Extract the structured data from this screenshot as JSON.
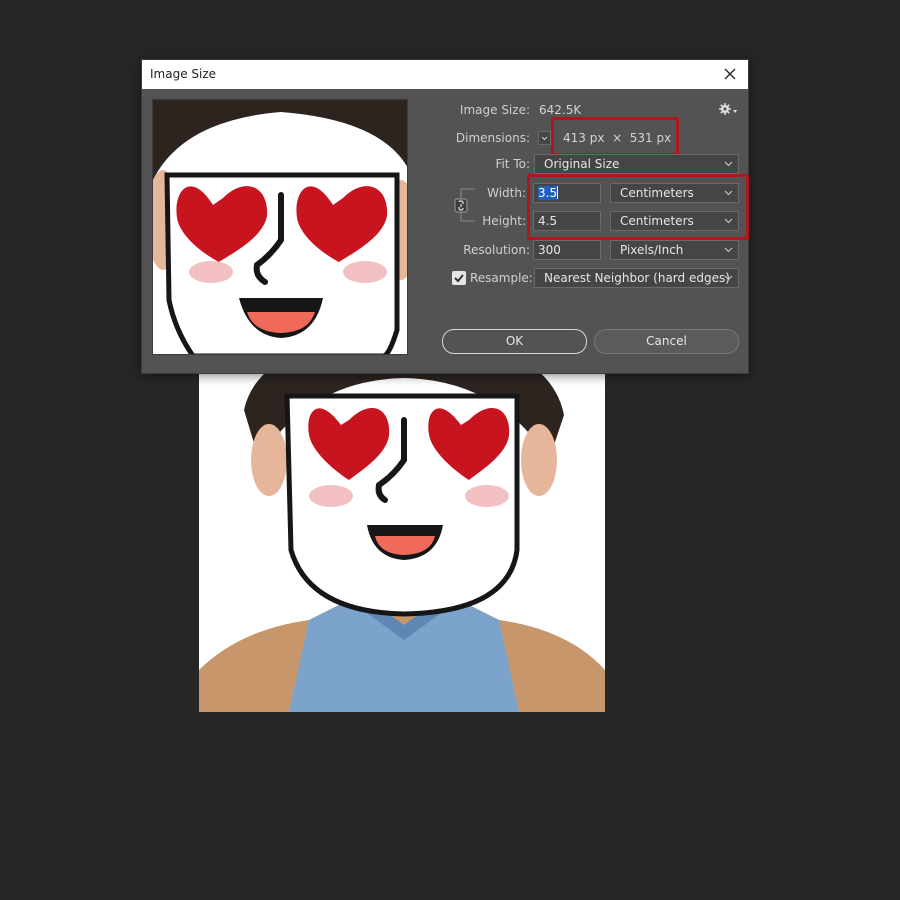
{
  "dialog": {
    "title": "Image Size",
    "image_size_label": "Image Size:",
    "image_size_value": "642.5K",
    "dimensions_label": "Dimensions:",
    "dimensions_value": "413 px  ×  531 px",
    "fit_to_label": "Fit To:",
    "fit_to_value": "Original Size",
    "width_label": "Width:",
    "width_value": "3.5",
    "width_unit": "Centimeters",
    "height_label": "Height:",
    "height_value": "4.5",
    "height_unit": "Centimeters",
    "resolution_label": "Resolution:",
    "resolution_value": "300",
    "resolution_unit": "Pixels/Inch",
    "resample_label": "Resample:",
    "resample_checked": true,
    "resample_value": "Nearest Neighbor (hard edges)",
    "ok_label": "OK",
    "cancel_label": "Cancel"
  },
  "icons": {
    "close": "close-icon",
    "gear": "gear-icon",
    "chain": "chain-link-icon",
    "chevron": "chevron-down-icon",
    "checkmark": "checkmark-icon"
  },
  "colors": {
    "app_background": "#262626",
    "dialog_background": "#535353",
    "highlight_red": "#b0171c",
    "selection_blue": "#1f5fbf",
    "heart_red": "#c8141f"
  }
}
